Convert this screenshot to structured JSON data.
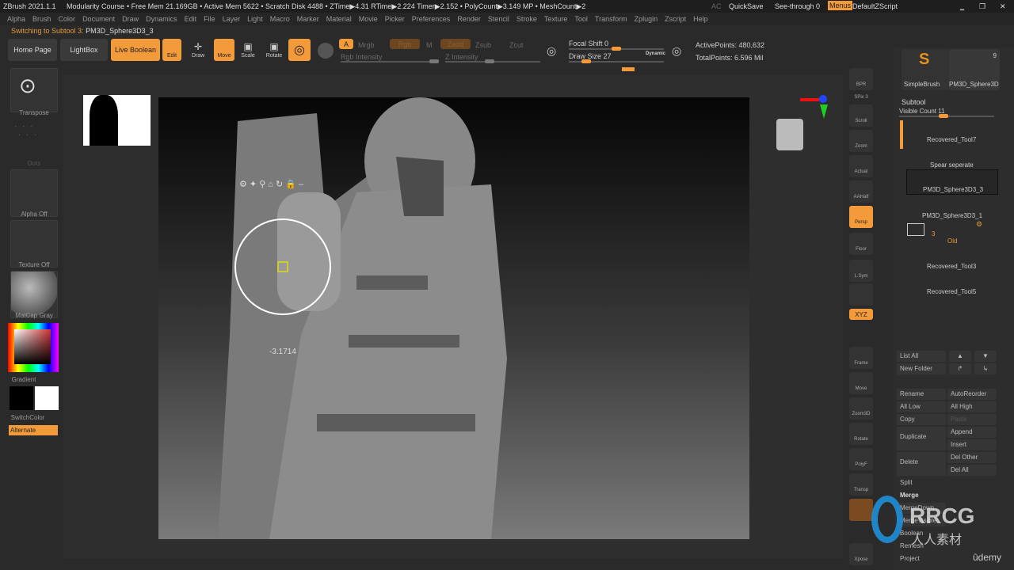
{
  "titlebar": {
    "app": "ZBrush 2021.1.1",
    "project": "Modularity Course",
    "stats": "• Free Mem 21.169GB • Active Mem 5622 • Scratch Disk 4488 • ZTime▶4.31 RTime▶2.224 Timer▶2.152 • PolyCount▶3.149 MP • MeshCount▶2",
    "ac": "AC",
    "quicksave": "QuickSave",
    "see_through": "See-through  0",
    "menus": "Menus",
    "default_zscript": "DefaultZScript"
  },
  "menu": [
    "Alpha",
    "Brush",
    "Color",
    "Document",
    "Draw",
    "Dynamics",
    "Edit",
    "File",
    "Layer",
    "Light",
    "Macro",
    "Marker",
    "Material",
    "Movie",
    "Picker",
    "Preferences",
    "Render",
    "Stencil",
    "Stroke",
    "Texture",
    "Tool",
    "Transform",
    "Zplugin",
    "Zscript",
    "Help"
  ],
  "notice": {
    "prefix": "Switching to Subtool 3:",
    "name": "PM3D_Sphere3D3_3"
  },
  "toolbar": {
    "home": "Home Page",
    "lightbox": "LightBox",
    "live_boolean": "Live Boolean",
    "edit": "Edit",
    "draw": "Draw",
    "move": "Move",
    "scale": "Scale",
    "rotate": "Rotate",
    "a": "A",
    "mrgb": "Mrgb",
    "rgb": "Rgb",
    "m": "M",
    "zadd": "Zadd",
    "zsub": "Zsub",
    "zcut": "Zcut",
    "rgb_intensity": "Rgb Intensity",
    "z_intensity": "Z Intensity",
    "focal_shift": "Focal Shift 0",
    "draw_size": "Draw Size 27",
    "dynamic": "Dynamic",
    "active_points": "ActivePoints: 480,632",
    "total_points": "TotalPoints: 6.596 Mil"
  },
  "left": {
    "transpose": "Transpose",
    "dots": "Dots",
    "alpha": "Alpha Off",
    "texture": "Texture Off",
    "matcap": "MatCap Gray",
    "gradient": "Gradient",
    "switchcolor": "SwitchColor",
    "alternate": "Alternate"
  },
  "viewport": {
    "readout": "-3.1714"
  },
  "shelf": [
    "BPR",
    "SPix 3",
    "Scroll",
    "Zoom",
    "Actual",
    "AAHalf",
    "Persp",
    "Floor",
    "L.Sym",
    "",
    "XYZ",
    "",
    "",
    "Frame",
    "Move",
    "Zoom3D",
    "Rotate",
    "PolyF",
    "Transp",
    "",
    "Xpose"
  ],
  "right": {
    "brush": "SimpleBrush",
    "tool": "PM3D_Sphere3D",
    "tool_count": "9",
    "subtool_title": "Subtool",
    "visible_count": "Visible Count 11",
    "subtools": [
      "Recovered_Tool7",
      "Spear seperate",
      "PM3D_Sphere3D3_3",
      "PM3D_Sphere3D3_1",
      "Recovered_Tool3",
      "Recovered_Tool5"
    ],
    "folder": {
      "count": "3",
      "name": "Old"
    },
    "buttons": {
      "list_all": "List All",
      "new_folder": "New Folder",
      "rename": "Rename",
      "autoreorder": "AutoReorder",
      "all_low": "All Low",
      "all_high": "All High",
      "copy": "Copy",
      "paste": "Paste",
      "duplicate": "Duplicate",
      "append": "Append",
      "insert": "Insert",
      "delete": "Delete",
      "del_other": "Del Other",
      "del_all": "Del All",
      "split": "Split",
      "merge": "Merge",
      "mergedown": "MergeDown",
      "mergevisible": "MergeVisible",
      "boolean": "Boolean",
      "remesh": "Remesh",
      "project": "Project"
    }
  },
  "watermark": {
    "brand": "RRCG",
    "sub": "人人素材",
    "udemy": "ûdemy"
  },
  "colors": {
    "accent": "#f39a3a",
    "bg": "#2a2a2a"
  }
}
